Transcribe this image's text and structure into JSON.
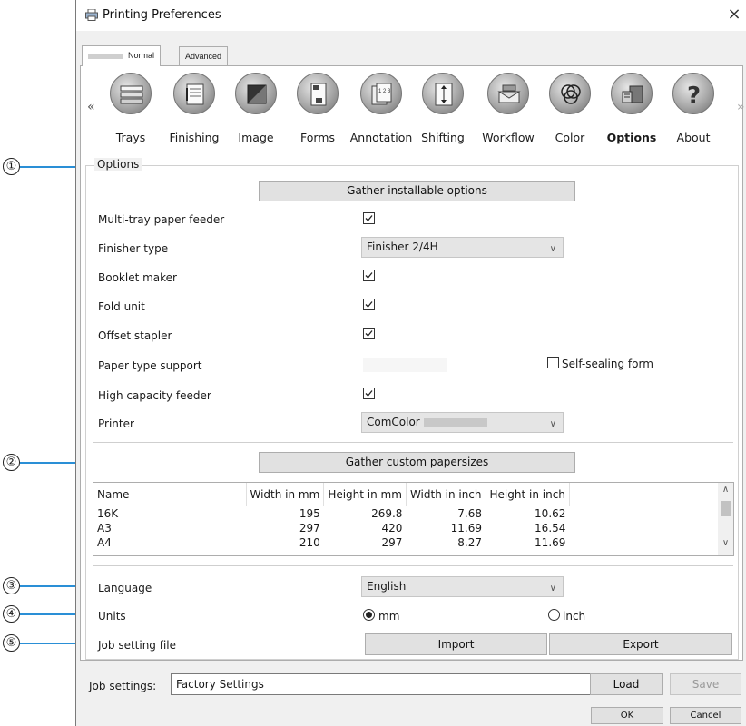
{
  "window": {
    "title": "Printing Preferences",
    "close": "×"
  },
  "mode_tabs": [
    {
      "label": "Normal"
    },
    {
      "label": "Advanced"
    }
  ],
  "toolbar": {
    "left_chevron": "«",
    "right_chevron": "»",
    "items": [
      {
        "label": "Trays",
        "icon": "trays-icon"
      },
      {
        "label": "Finishing",
        "icon": "finishing-icon"
      },
      {
        "label": "Image",
        "icon": "image-icon"
      },
      {
        "label": "Forms",
        "icon": "forms-icon"
      },
      {
        "label": "Annotation",
        "icon": "annotation-icon"
      },
      {
        "label": "Shifting",
        "icon": "shifting-icon"
      },
      {
        "label": "Workflow",
        "icon": "workflow-icon"
      },
      {
        "label": "Color",
        "icon": "color-icon"
      },
      {
        "label": "Options",
        "icon": "options-icon",
        "selected": true
      },
      {
        "label": "About",
        "icon": "about-icon"
      }
    ]
  },
  "callouts": [
    "①",
    "②",
    "③",
    "④",
    "⑤"
  ],
  "options": {
    "group_title": "Options",
    "gather_installable": "Gather installable options",
    "multi_tray_label": "Multi-tray paper feeder",
    "multi_tray_checked": true,
    "finisher_label": "Finisher type",
    "finisher_value": "Finisher 2/4H",
    "booklet_label": "Booklet maker",
    "booklet_checked": true,
    "fold_label": "Fold unit",
    "fold_checked": true,
    "offset_label": "Offset stapler",
    "offset_checked": true,
    "paper_type_label": "Paper type support",
    "self_sealing_label": "Self-sealing form",
    "self_sealing_checked": false,
    "high_capacity_label": "High capacity feeder",
    "high_capacity_checked": true,
    "printer_label": "Printer",
    "printer_value": "ComColor",
    "gather_custom": "Gather custom papersizes",
    "papersizes": {
      "columns": [
        "Name",
        "Width in mm",
        "Height in mm",
        "Width in inch",
        "Height in inch"
      ],
      "rows": [
        [
          "16K",
          "195",
          "269.8",
          "7.68",
          "10.62"
        ],
        [
          "A3",
          "297",
          "420",
          "11.69",
          "16.54"
        ],
        [
          "A4",
          "210",
          "297",
          "8.27",
          "11.69"
        ]
      ]
    },
    "language_label": "Language",
    "language_value": "English",
    "units_label": "Units",
    "unit_mm": "mm",
    "unit_inch": "inch",
    "unit_selected": "mm",
    "job_file_label": "Job setting file",
    "import": "Import",
    "export": "Export"
  },
  "footer": {
    "job_settings_label": "Job settings:",
    "job_settings_value": "Factory Settings",
    "load": "Load",
    "save": "Save",
    "ok": "OK",
    "cancel": "Cancel"
  },
  "colors": {
    "callout_line": "#2a8fd6",
    "window_bg": "#f0f0f0",
    "button_bg": "#e1e1e1"
  }
}
